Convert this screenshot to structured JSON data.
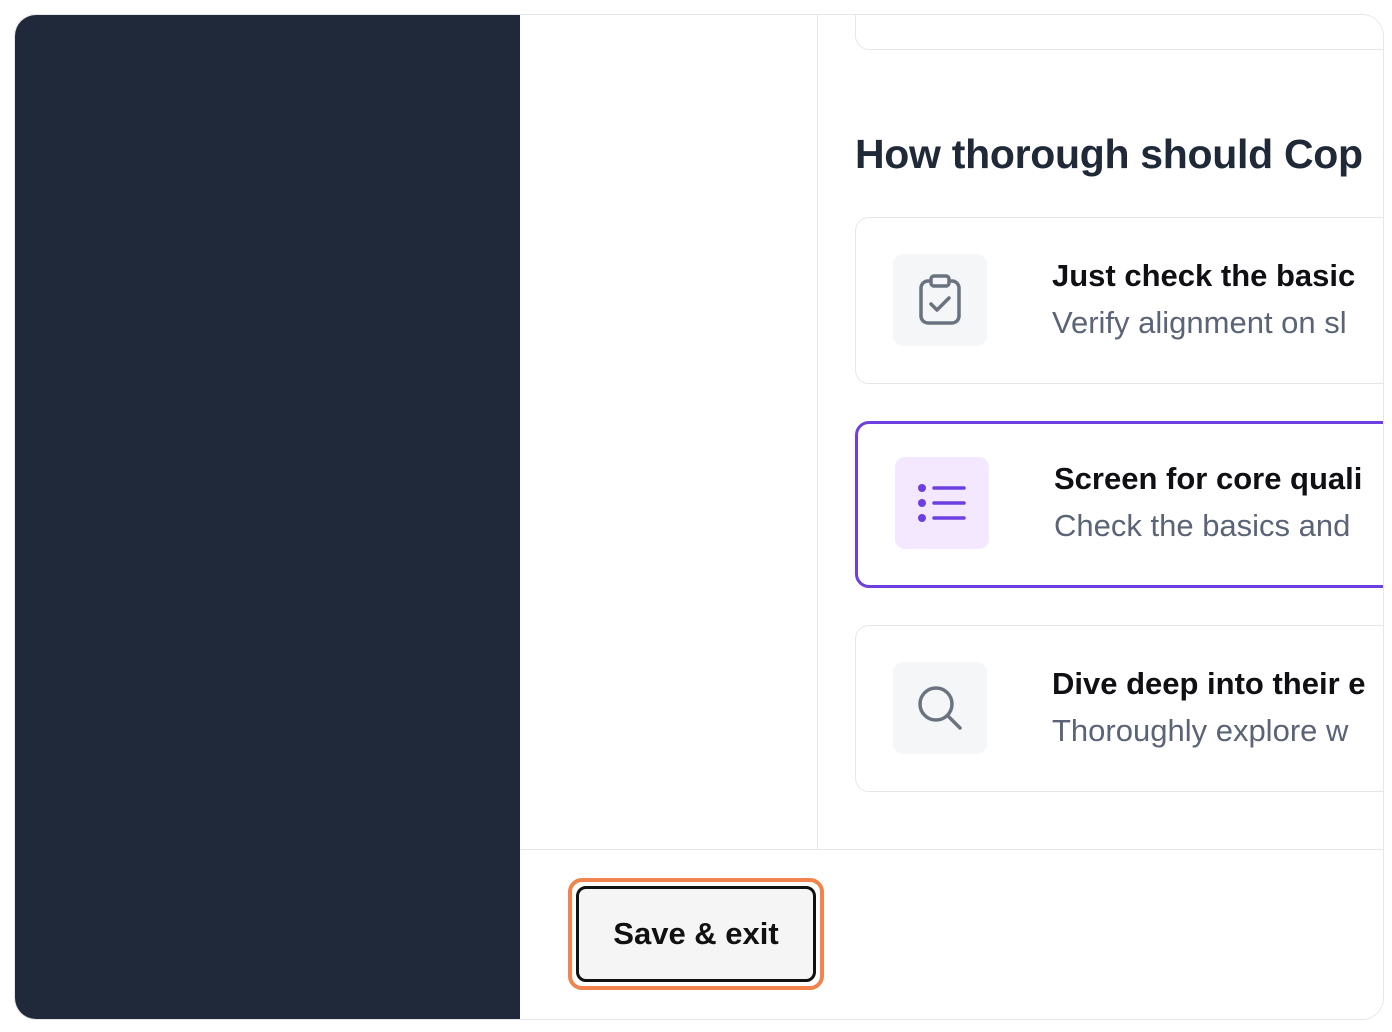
{
  "question": {
    "heading": "How thorough should Cop"
  },
  "options": [
    {
      "title": "Just check the basic",
      "description": "Verify alignment on sl",
      "icon": "clipboard-check-icon",
      "selected": false
    },
    {
      "title": "Screen for core quali",
      "description": "Check the basics and",
      "icon": "list-icon",
      "selected": true
    },
    {
      "title": "Dive deep into their e",
      "description": "Thoroughly explore w",
      "icon": "search-icon",
      "selected": false
    }
  ],
  "footer": {
    "save_exit_label": "Save & exit"
  },
  "colors": {
    "sidebar_bg": "#202939",
    "selected_border": "#6d3fe0",
    "selected_icon_bg": "#f3e8ff",
    "selected_icon": "#6d3fe0",
    "highlight": "#f0834e"
  }
}
